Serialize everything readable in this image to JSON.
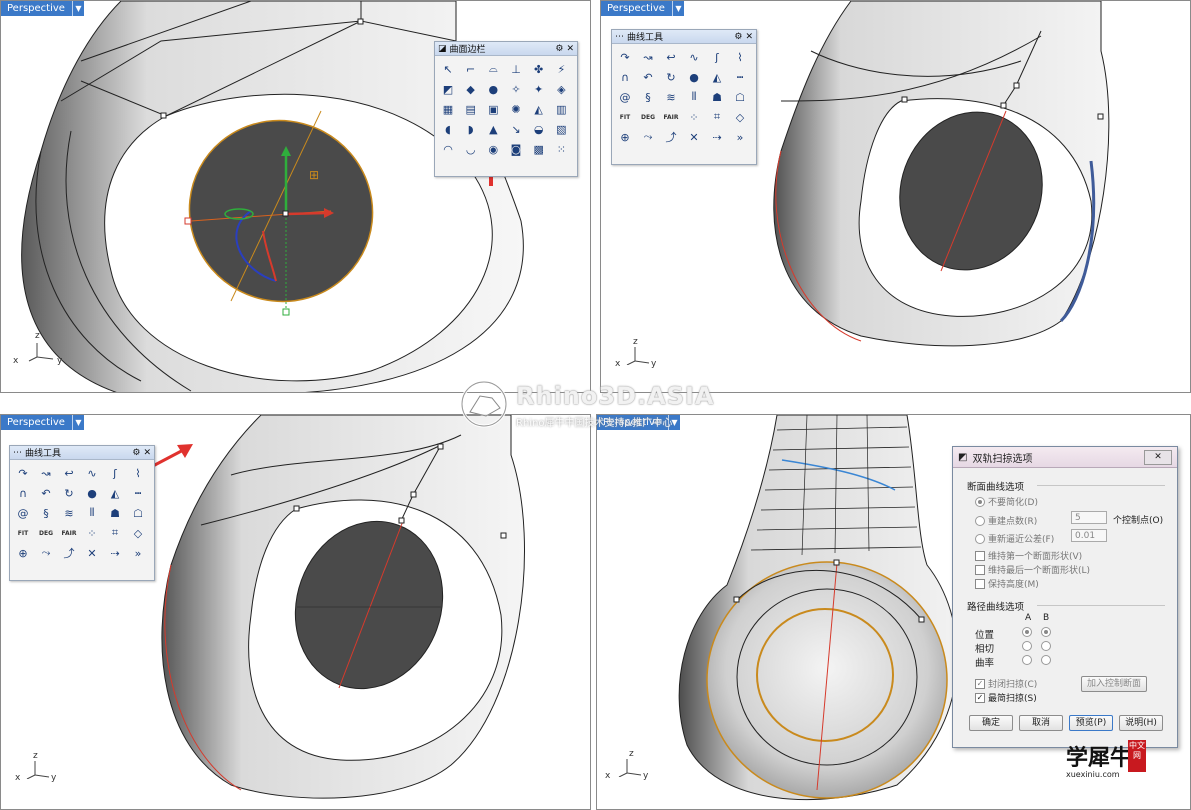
{
  "viewports": [
    {
      "label": "Perspective",
      "axes": {
        "x": "x",
        "y": "y",
        "z": "z"
      }
    },
    {
      "label": "Perspective",
      "axes": {
        "x": "x",
        "y": "y",
        "z": "z"
      }
    },
    {
      "label": "Perspective",
      "axes": {
        "x": "x",
        "y": "y",
        "z": "z"
      }
    },
    {
      "label": "Perspective",
      "axes": {
        "x": "x",
        "y": "y",
        "z": "z"
      }
    }
  ],
  "surface_toolbar": {
    "title": "曲面边栏"
  },
  "curve_toolbar": {
    "title": "曲线工具"
  },
  "curve_toolbar_labels": {
    "fit": "FIT",
    "deg": "DEG",
    "fair": "FAIR",
    "more": "»"
  },
  "sweep_dialog": {
    "title": "双轨扫掠选项",
    "close": "✕",
    "section_cross": "断面曲线选项",
    "opt_no_simplify": "不要简化(D)",
    "opt_rebuild": "重建点数(R)",
    "rebuild_value": "5",
    "rebuild_unit": "个控制点(O)",
    "opt_refit": "重新逼近公差(F)",
    "refit_value": "0.01",
    "chk_keep_first": "维持第一个断面形状(V)",
    "chk_keep_last": "维持最后一个断面形状(L)",
    "chk_keep_height": "保持高度(M)",
    "section_rail": "路径曲线选项",
    "col_a": "A",
    "col_b": "B",
    "rail_position": "位置",
    "rail_tangent": "相切",
    "rail_curvature": "曲率",
    "chk_closed": "封闭扫掠(C)",
    "chk_simple": "最简扫掠(S)",
    "btn_add_slash": "加入控制断面",
    "btn_ok": "确定",
    "btn_cancel": "取消",
    "btn_preview": "预览(P)",
    "btn_help": "说明(H)"
  },
  "watermark": {
    "brand": "Rhino3D.ASIA",
    "sub": "Rhino犀牛中国技术支持&推广中心"
  },
  "corner_logo": {
    "name": "学犀牛",
    "badge": "中文网",
    "url": "xuexiniu.com"
  },
  "colors": {
    "tab_blue": "#3b79c8",
    "arrow_red": "#e0322e",
    "disc_dark": "#4a4a4a",
    "orange": "#c98a1d"
  }
}
